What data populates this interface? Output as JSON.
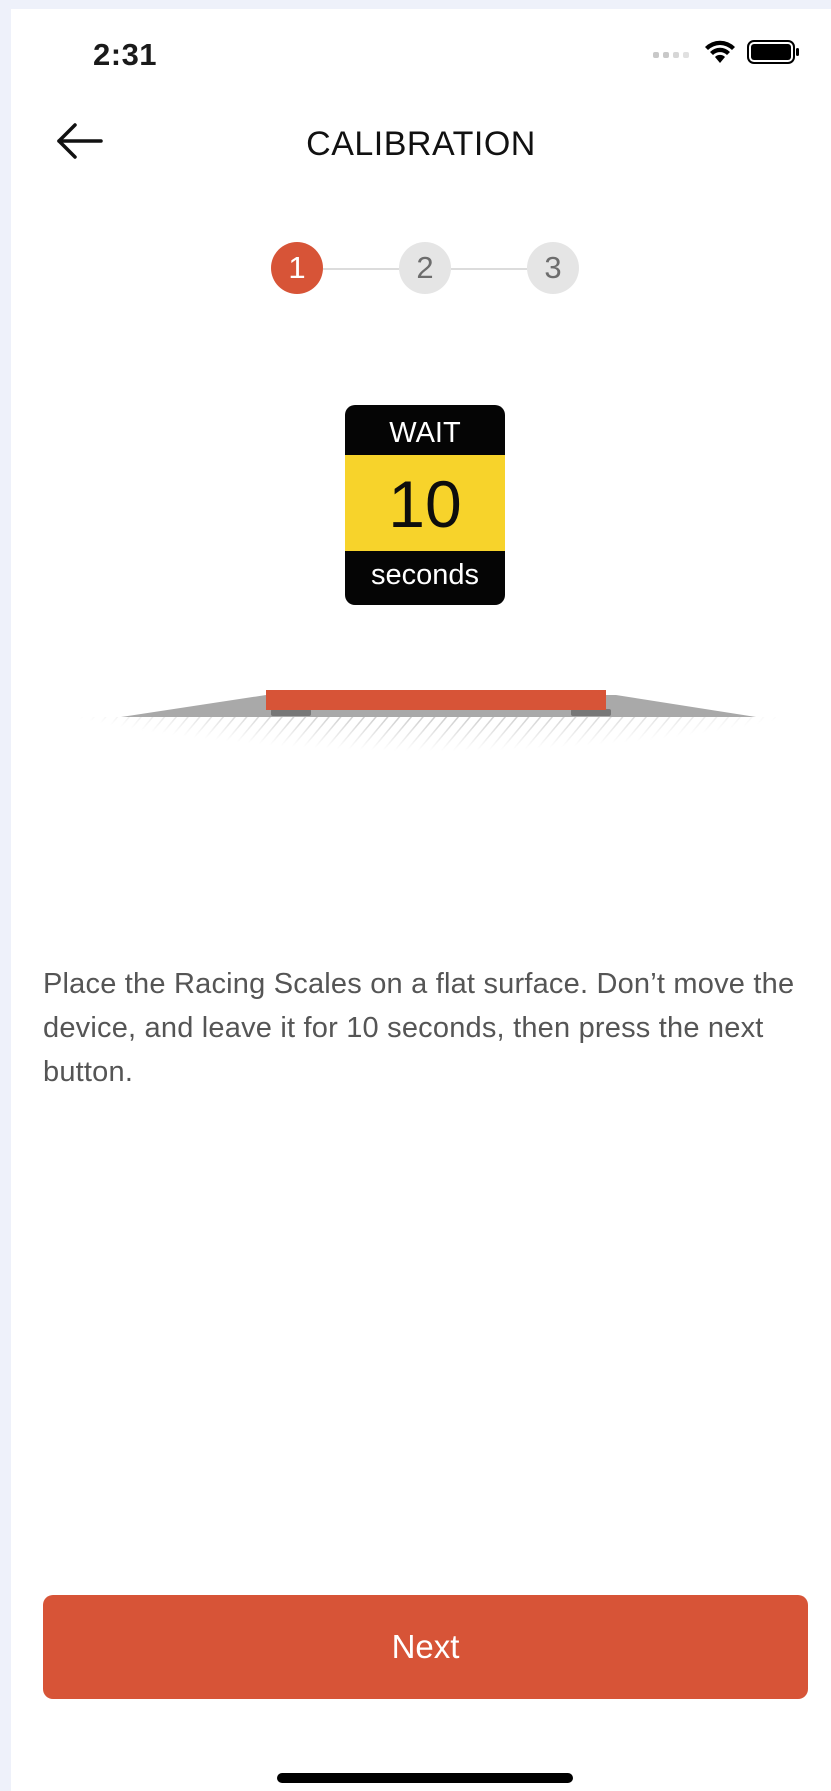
{
  "status_bar": {
    "time": "2:31",
    "icons": [
      "signal-icon",
      "wifi-icon",
      "battery-icon"
    ]
  },
  "nav": {
    "back_icon": "arrow-left-icon",
    "title": "CALIBRATION"
  },
  "stepper": {
    "steps": [
      "1",
      "2",
      "3"
    ],
    "current_step": 1
  },
  "wait_sign": {
    "top": "WAIT",
    "value": "10",
    "bottom": "seconds"
  },
  "description": "Place the Racing Scales on a flat surface. Don’t move the device, and leave it for 10 seconds, then press the next button.",
  "next_button": {
    "label": "Next"
  },
  "colors": {
    "accent": "#d75437",
    "sign_yellow": "#f7d32b",
    "inactive_step": "#e5e5e5",
    "background": "#ffffff"
  }
}
